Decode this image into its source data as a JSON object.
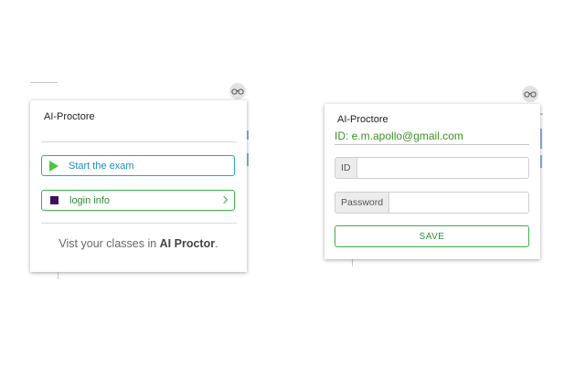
{
  "left_popup": {
    "title": "AI-Proctore",
    "extension_icon": "glasses-icon",
    "start_button": {
      "label": "Start the exam",
      "icon": "play-icon"
    },
    "login_button": {
      "label": "login info",
      "icon": "square-icon",
      "trailing_icon": "chevron-right-icon"
    },
    "footer": {
      "prefix": "Vist your classes in ",
      "brand": "AI Proctor",
      "suffix": "."
    }
  },
  "right_popup": {
    "title": "AI-Proctore",
    "extension_icon": "glasses-icon",
    "user_id": "ID: e.m.apollo@gmail.com",
    "id_field": {
      "label": "ID",
      "value": "",
      "placeholder": ""
    },
    "password_field": {
      "label": "Password",
      "value": "",
      "placeholder": ""
    },
    "save_label": "SAVE"
  },
  "colors": {
    "start_border": "#2fa1c8",
    "start_icon": "#4cc640",
    "login_border": "#3fb04c",
    "login_icon": "#3a1160",
    "user_id_text": "#3f8f2a"
  }
}
